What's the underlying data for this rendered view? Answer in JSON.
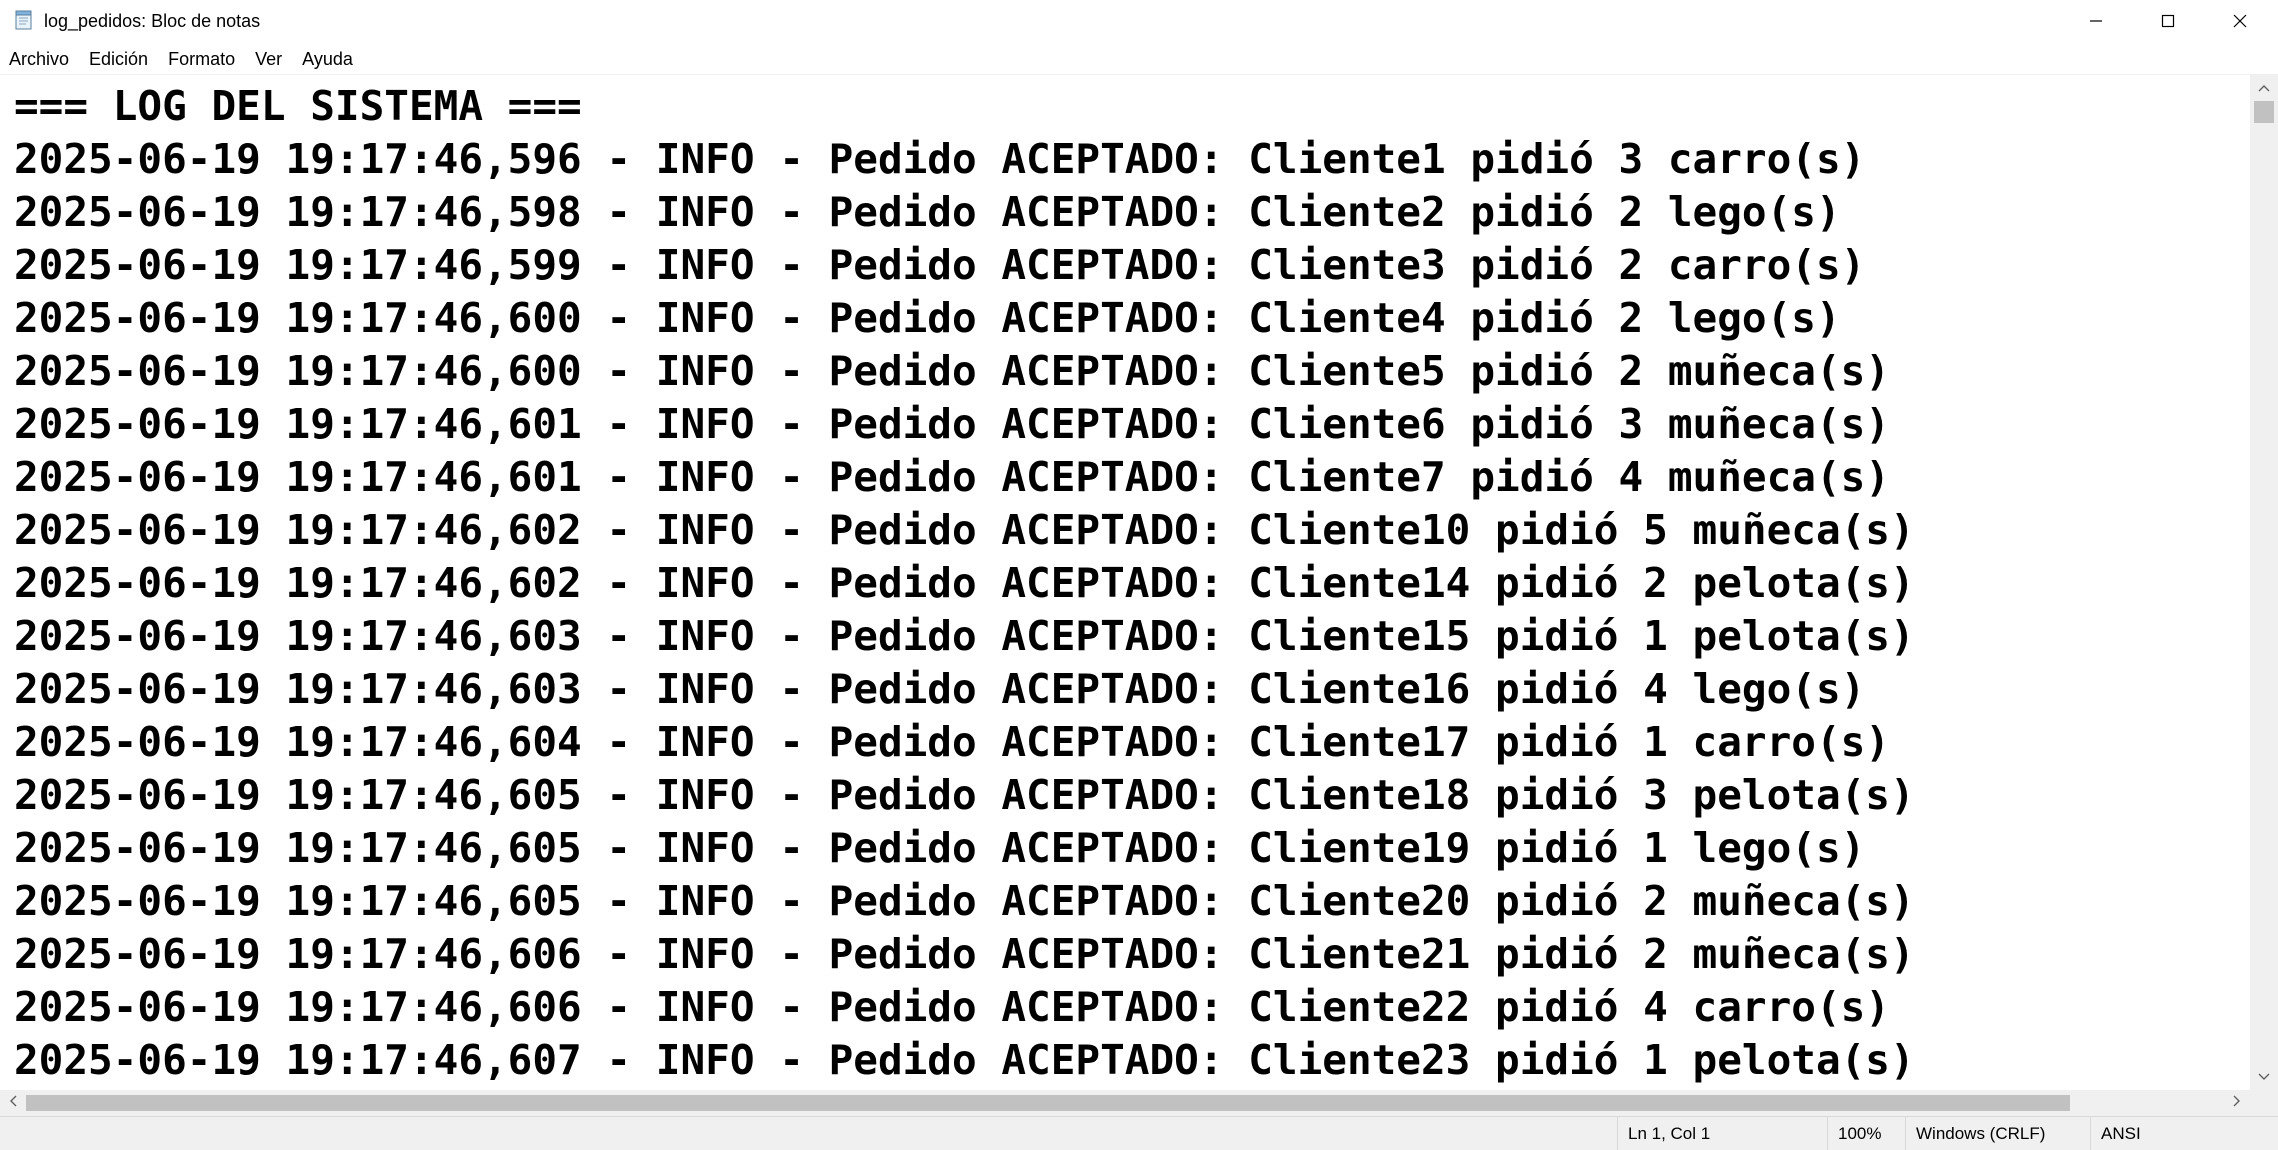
{
  "window": {
    "title": "log_pedidos: Bloc de notas",
    "icon": "notepad-icon"
  },
  "title_buttons": {
    "minimize": "minimize-icon",
    "maximize": "maximize-icon",
    "close": "close-icon"
  },
  "menu": {
    "items": [
      {
        "label": "Archivo"
      },
      {
        "label": "Edición"
      },
      {
        "label": "Formato"
      },
      {
        "label": "Ver"
      },
      {
        "label": "Ayuda"
      }
    ]
  },
  "editor": {
    "lines": [
      "=== LOG DEL SISTEMA ===",
      "2025-06-19 19:17:46,596 - INFO - Pedido ACEPTADO: Cliente1 pidió 3 carro(s)",
      "2025-06-19 19:17:46,598 - INFO - Pedido ACEPTADO: Cliente2 pidió 2 lego(s)",
      "2025-06-19 19:17:46,599 - INFO - Pedido ACEPTADO: Cliente3 pidió 2 carro(s)",
      "2025-06-19 19:17:46,600 - INFO - Pedido ACEPTADO: Cliente4 pidió 2 lego(s)",
      "2025-06-19 19:17:46,600 - INFO - Pedido ACEPTADO: Cliente5 pidió 2 muñeca(s)",
      "2025-06-19 19:17:46,601 - INFO - Pedido ACEPTADO: Cliente6 pidió 3 muñeca(s)",
      "2025-06-19 19:17:46,601 - INFO - Pedido ACEPTADO: Cliente7 pidió 4 muñeca(s)",
      "2025-06-19 19:17:46,602 - INFO - Pedido ACEPTADO: Cliente10 pidió 5 muñeca(s)",
      "2025-06-19 19:17:46,602 - INFO - Pedido ACEPTADO: Cliente14 pidió 2 pelota(s)",
      "2025-06-19 19:17:46,603 - INFO - Pedido ACEPTADO: Cliente15 pidió 1 pelota(s)",
      "2025-06-19 19:17:46,603 - INFO - Pedido ACEPTADO: Cliente16 pidió 4 lego(s)",
      "2025-06-19 19:17:46,604 - INFO - Pedido ACEPTADO: Cliente17 pidió 1 carro(s)",
      "2025-06-19 19:17:46,605 - INFO - Pedido ACEPTADO: Cliente18 pidió 3 pelota(s)",
      "2025-06-19 19:17:46,605 - INFO - Pedido ACEPTADO: Cliente19 pidió 1 lego(s)",
      "2025-06-19 19:17:46,605 - INFO - Pedido ACEPTADO: Cliente20 pidió 2 muñeca(s)",
      "2025-06-19 19:17:46,606 - INFO - Pedido ACEPTADO: Cliente21 pidió 2 muñeca(s)",
      "2025-06-19 19:17:46,606 - INFO - Pedido ACEPTADO: Cliente22 pidió 4 carro(s)",
      "2025-06-19 19:17:46,607 - INFO - Pedido ACEPTADO: Cliente23 pidió 1 pelota(s)"
    ]
  },
  "status": {
    "position": "Ln 1, Col 1",
    "zoom": "100%",
    "line_ending": "Windows (CRLF)",
    "encoding": "ANSI"
  },
  "colors": {
    "chrome": "#f0f0f0",
    "scroll_thumb": "#c1c1c1",
    "text": "#000000",
    "background": "#ffffff"
  }
}
